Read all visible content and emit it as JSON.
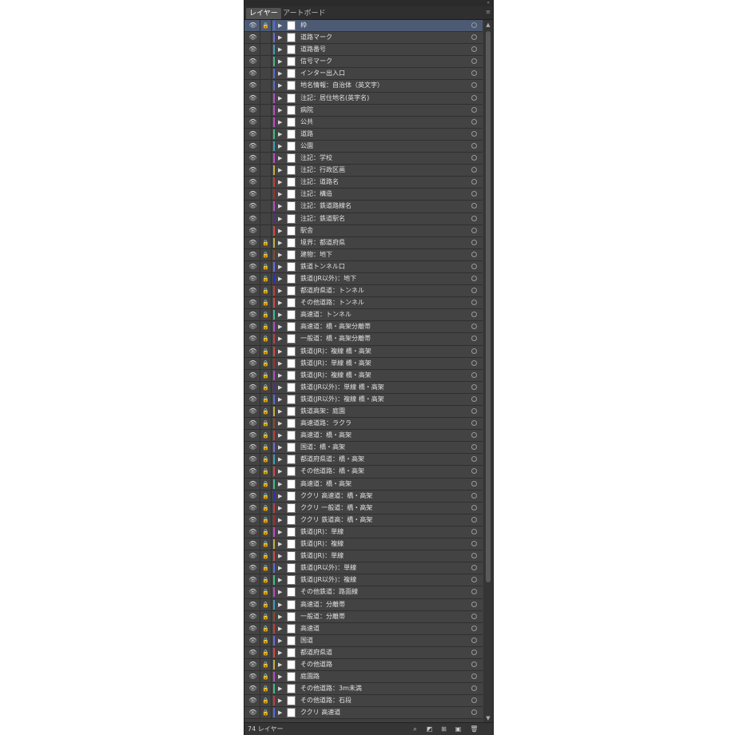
{
  "tabs": [
    {
      "label": "レイヤー",
      "active": true
    },
    {
      "label": "アートボード",
      "active": false
    }
  ],
  "footer": {
    "count_label": "74 レイヤー"
  },
  "layers": [
    {
      "name": "枠",
      "color": "#5b6bd8",
      "selected": true,
      "locked": true
    },
    {
      "name": "道路マーク",
      "color": "#6a6ae0",
      "locked": false
    },
    {
      "name": "道路番号",
      "color": "#3aa0b8",
      "locked": false
    },
    {
      "name": "信号マーク",
      "color": "#44b88c",
      "locked": false
    },
    {
      "name": "インター出入口",
      "color": "#5b6bd8",
      "locked": false
    },
    {
      "name": "地名情報：自治体（英文字）",
      "color": "#5b6bd8",
      "locked": false
    },
    {
      "name": "注記：居住地名(英字名)",
      "color": "#b050c0",
      "locked": false
    },
    {
      "name": "病院",
      "color": "#c04ac8",
      "locked": false
    },
    {
      "name": "公共",
      "color": "#c04ac8",
      "locked": false
    },
    {
      "name": "道路",
      "color": "#44b88c",
      "locked": false
    },
    {
      "name": "公園",
      "color": "#3aa0b8",
      "locked": false
    },
    {
      "name": "注記：学校",
      "color": "#c04ac8",
      "locked": false
    },
    {
      "name": "注記：行政区画",
      "color": "#c0b040",
      "locked": false
    },
    {
      "name": "注記：道路名",
      "color": "#c04040",
      "locked": false
    },
    {
      "name": "注記：構造",
      "color": "#a03030",
      "locked": false
    },
    {
      "name": "注記：鉄道路線名",
      "color": "#b050c0",
      "locked": false
    },
    {
      "name": "注記：鉄道駅名",
      "color": "#503080",
      "locked": false
    },
    {
      "name": "駅舎",
      "color": "#d04a4a",
      "locked": false
    },
    {
      "name": "境界：都道府県",
      "color": "#c0b040",
      "locked": true
    },
    {
      "name": "建物：地下",
      "color": "#8a4a30",
      "locked": true
    },
    {
      "name": "鉄道トンネル口",
      "color": "#6a6ae0",
      "locked": true
    },
    {
      "name": "鉄道(JR以外)：地下",
      "color": "#2e2ec0",
      "locked": true
    },
    {
      "name": "都道府県道：トンネル",
      "color": "#c04040",
      "locked": true
    },
    {
      "name": "その他道路：トンネル",
      "color": "#d04a4a",
      "locked": true
    },
    {
      "name": "高速道：トンネル",
      "color": "#44b88c",
      "locked": true
    },
    {
      "name": "高速道：橋・高架分離帯",
      "color": "#b050c0",
      "locked": true
    },
    {
      "name": "一般道：橋・高架分離帯",
      "color": "#c04040",
      "locked": true
    },
    {
      "name": "鉄道(JR)：複線 橋・高架",
      "color": "#d04a4a",
      "locked": true
    },
    {
      "name": "鉄道(JR)：単線 橋・高架",
      "color": "#a03030",
      "locked": true
    },
    {
      "name": "鉄道(JR)：複線 橋・高架",
      "color": "#b050c0",
      "locked": true
    },
    {
      "name": "鉄道(JR以外)：単線 橋・高架",
      "color": "#503080",
      "locked": true
    },
    {
      "name": "鉄道(JR以外)：複線 橋・高架",
      "color": "#5b6bd8",
      "locked": true
    },
    {
      "name": "鉄道高架：庭園",
      "color": "#c0b040",
      "locked": true
    },
    {
      "name": "高速道路：ラクラ",
      "color": "#8a4a30",
      "locked": true
    },
    {
      "name": "高速道：橋・高架",
      "color": "#c04040",
      "locked": true
    },
    {
      "name": "国道：橋・高架",
      "color": "#6a6ae0",
      "locked": true
    },
    {
      "name": "都道府県道：橋・高架",
      "color": "#3aa0b8",
      "locked": true
    },
    {
      "name": "その他道路：橋・高架",
      "color": "#d04a4a",
      "locked": true
    },
    {
      "name": "高速道：橋・高架",
      "color": "#44b88c",
      "locked": true
    },
    {
      "name": "ククリ 高速道：橋・高架",
      "color": "#2e2ec0",
      "locked": true
    },
    {
      "name": "ククリ 一般道：橋・高架",
      "color": "#c04040",
      "locked": true
    },
    {
      "name": "ククリ 鉄道高：橋・高架",
      "color": "#a03030",
      "locked": true
    },
    {
      "name": "鉄道(JR)：単線",
      "color": "#c04ac8",
      "locked": true
    },
    {
      "name": "鉄道(JR)：複線",
      "color": "#c0b040",
      "locked": true
    },
    {
      "name": "鉄道(JR)：単線",
      "color": "#d04a4a",
      "locked": true
    },
    {
      "name": "鉄道(JR以外)：単線",
      "color": "#5b6bd8",
      "locked": true
    },
    {
      "name": "鉄道(JR以外)：複線",
      "color": "#44b88c",
      "locked": true
    },
    {
      "name": "その他鉄道：路面線",
      "color": "#b050c0",
      "locked": true
    },
    {
      "name": "高速道：分離帯",
      "color": "#3aa0b8",
      "locked": true
    },
    {
      "name": "一般道：分離帯",
      "color": "#8a4a30",
      "locked": true
    },
    {
      "name": "高速道",
      "color": "#c04040",
      "locked": true
    },
    {
      "name": "国道",
      "color": "#6a6ae0",
      "locked": true
    },
    {
      "name": "都道府県道",
      "color": "#d04a4a",
      "locked": true
    },
    {
      "name": "その他道路",
      "color": "#c0b040",
      "locked": true
    },
    {
      "name": "庭園路",
      "color": "#b050c0",
      "locked": true
    },
    {
      "name": "その他道路：3m未満",
      "color": "#44b88c",
      "locked": true
    },
    {
      "name": "その他道路：石段",
      "color": "#c04040",
      "locked": true
    },
    {
      "name": "ククリ 高速道",
      "color": "#5b6bd8",
      "locked": true
    }
  ]
}
